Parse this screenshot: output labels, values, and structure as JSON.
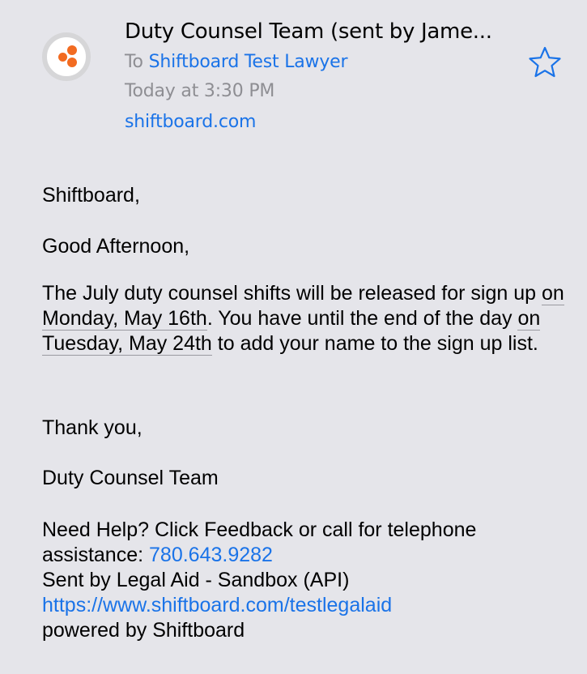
{
  "header": {
    "sender": "Duty Counsel Team (sent by Jame...",
    "to_prefix": "To",
    "recipient": "Shiftboard Test Lawyer",
    "date": "Today at 3:30 PM",
    "domain": "shiftboard.com",
    "avatar_icon": "shiftboard-logo-icon",
    "star_icon": "star-outline-icon"
  },
  "body": {
    "greeting": "Shiftboard,",
    "salutation": "Good Afternoon,",
    "main_part1": "The July duty counsel shifts will be released for sign up ",
    "main_date1": "on Monday, May 16th",
    "main_part2": ". You have until the end of the day ",
    "main_date2": "on Tuesday, May 24th",
    "main_part3": " to add your name to the sign up list.",
    "thanks": "Thank you,",
    "signature": "Duty Counsel Team",
    "help_text": "Need Help? Click Feedback or call for telephone assistance: ",
    "phone": "780.643.9282",
    "sent_by": "Sent by Legal Aid - Sandbox (API)",
    "url": "https://www.shiftboard.com/testlegalaid",
    "powered_by": "powered by Shiftboard"
  },
  "colors": {
    "background": "#e5e5ea",
    "link": "#1a73e8",
    "secondary_text": "#8e8e93",
    "logo_orange": "#f26b21"
  }
}
